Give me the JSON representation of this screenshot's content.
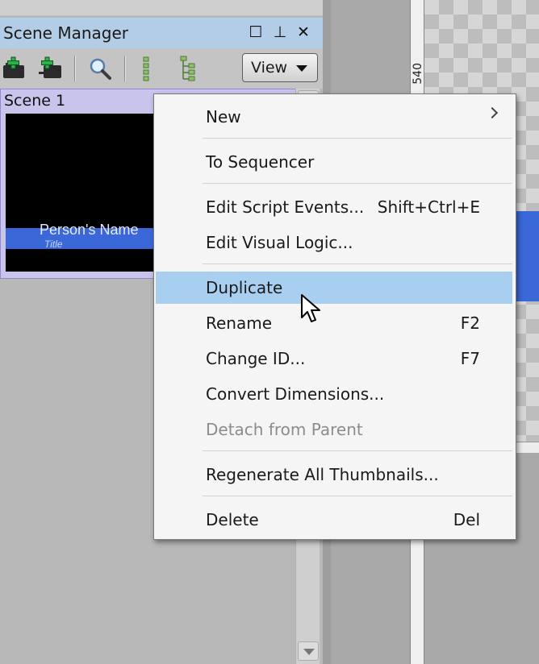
{
  "panel": {
    "title": "Scene Manager",
    "title_buttons": {
      "restore_glyph": "☐",
      "pin_glyph": "⊥",
      "close_glyph": "✕"
    },
    "toolbar": {
      "view_label": "View"
    },
    "scene": {
      "label": "Scene 1",
      "thumbnail": {
        "name_text": "Person's Name",
        "title_text": "Title"
      }
    }
  },
  "ruler": {
    "value": "540"
  },
  "context_menu": {
    "items": [
      {
        "label": "New",
        "shortcut": "",
        "state": "normal",
        "has_submenu": true
      },
      {
        "label": "To Sequencer",
        "shortcut": "",
        "state": "normal"
      },
      {
        "label": "Edit Script Events...",
        "shortcut": "Shift+Ctrl+E",
        "state": "normal"
      },
      {
        "label": "Edit Visual Logic...",
        "shortcut": "",
        "state": "normal"
      },
      {
        "label": "Duplicate",
        "shortcut": "",
        "state": "highlighted"
      },
      {
        "label": "Rename",
        "shortcut": "F2",
        "state": "normal"
      },
      {
        "label": "Change ID...",
        "shortcut": "F7",
        "state": "normal"
      },
      {
        "label": "Convert Dimensions...",
        "shortcut": "",
        "state": "normal"
      },
      {
        "label": "Detach from Parent",
        "shortcut": "",
        "state": "disabled"
      },
      {
        "label": "Regenerate All Thumbnails...",
        "shortcut": "",
        "state": "normal"
      },
      {
        "label": "Delete",
        "shortcut": "Del",
        "state": "normal"
      }
    ]
  },
  "colors": {
    "title_bar": "#b4cde6",
    "highlight": "#a8cff0",
    "scene_selected": "#c8c4ec",
    "lower_third": "#3a68d8"
  }
}
